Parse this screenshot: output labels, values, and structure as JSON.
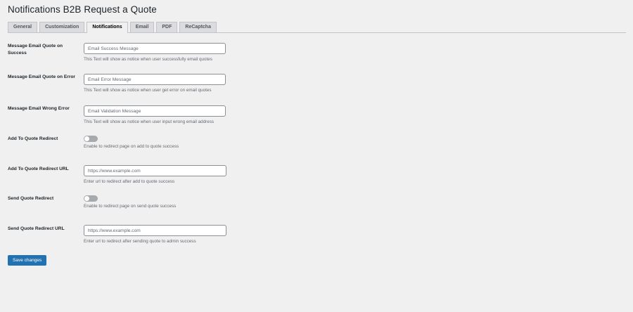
{
  "page": {
    "title": "Notifications B2B Request a Quote"
  },
  "tabs": [
    {
      "label": "General",
      "active": false
    },
    {
      "label": "Customization",
      "active": false
    },
    {
      "label": "Notifications",
      "active": true
    },
    {
      "label": "Email",
      "active": false
    },
    {
      "label": "PDF",
      "active": false
    },
    {
      "label": "ReCaptcha",
      "active": false
    }
  ],
  "fields": {
    "email_success": {
      "label": "Message Email Quote on Success",
      "value": "",
      "placeholder": "Email Success Message",
      "description": "This Text will show as notice when user successfully email quotes"
    },
    "email_error": {
      "label": "Message Email Quote on Error",
      "value": "",
      "placeholder": "Email Error Message",
      "description": "This Text will show as notice when user get error on email quotes"
    },
    "email_wrong": {
      "label": "Message Email Wrong Error",
      "value": "",
      "placeholder": "Email Validation Message",
      "description": "This Text will show as notice when user input wrong email address"
    },
    "add_to_quote_redirect": {
      "label": "Add To Quote Redirect",
      "enabled": false,
      "description": "Enable to redirect page on add to quote success"
    },
    "add_to_quote_redirect_url": {
      "label": "Add To Quote Redirect URL",
      "value": "",
      "placeholder": "https://www.example.com",
      "description": "Enter url to redirect after add to quote success"
    },
    "send_quote_redirect": {
      "label": "Send Quote Redirect",
      "enabled": false,
      "description": "Enable to redirect page on send quote success"
    },
    "send_quote_redirect_url": {
      "label": "Send Quote Redirect URL",
      "value": "",
      "placeholder": "https://www.example.com",
      "description": "Enter url to redirect after sending quote to admin success"
    }
  },
  "actions": {
    "save_label": "Save changes"
  },
  "colors": {
    "background": "#f0f0f1",
    "primary_button": "#2271b1",
    "toggle_off": "#a7aaad",
    "input_border": "#8c8f94",
    "description_text": "#646970"
  }
}
